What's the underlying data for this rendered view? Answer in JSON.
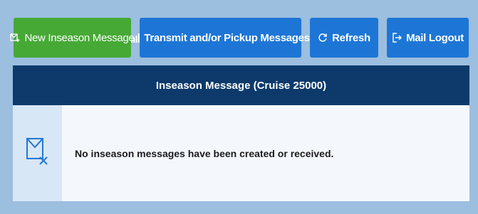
{
  "toolbar": {
    "new_message_label": "New Inseason Message",
    "transmit_label": "Transmit and/or Pickup Messages",
    "refresh_label": "Refresh",
    "logout_label": "Mail Logout"
  },
  "panel": {
    "title": "Inseason Message (Cruise 25000)",
    "empty_message": "No inseason messages have been created or received."
  },
  "icons": {
    "new_message": "compose-message-icon",
    "transmit": "signal-bars-icon",
    "refresh": "refresh-icon",
    "logout": "logout-icon",
    "empty_state": "mail-x-icon"
  },
  "colors": {
    "page_bg": "#9cbedf",
    "green_button": "#46a935",
    "blue_button": "#1d76d6",
    "header_bg": "#0d3a6b",
    "icon_col_bg": "#d8e7f6",
    "body_bg": "#f4f8fd"
  }
}
